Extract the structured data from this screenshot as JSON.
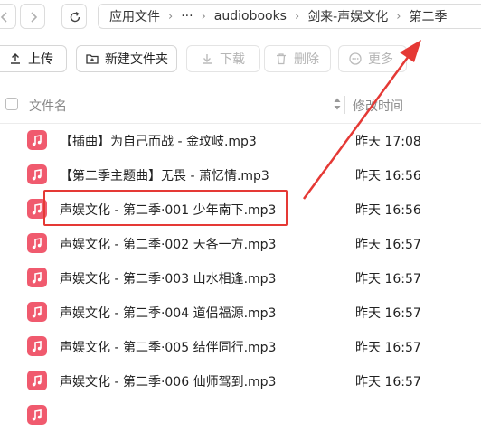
{
  "nav": {
    "back_icon": "chevron-left-icon",
    "forward_icon": "chevron-right-icon",
    "refresh_icon": "refresh-icon"
  },
  "breadcrumb": {
    "items": [
      "应用文件",
      "···",
      "audiobooks",
      "剑来-声娱文化",
      "第二季"
    ]
  },
  "toolbar": {
    "upload": "上传",
    "new_folder": "新建文件夹",
    "download": "下载",
    "delete": "删除",
    "more": "更多"
  },
  "list": {
    "header": {
      "name": "文件名",
      "modified": "修改时间"
    },
    "rows": [
      {
        "name": "【插曲】为自己而战 - 金玟岐.mp3",
        "time": "昨天 17:08"
      },
      {
        "name": "【第二季主题曲】无畏 - 萧忆情.mp3",
        "time": "昨天 16:56"
      },
      {
        "name": "声娱文化 - 第二季·001 少年南下.mp3",
        "time": "昨天 16:56"
      },
      {
        "name": "声娱文化 - 第二季·002 天各一方.mp3",
        "time": "昨天 16:57"
      },
      {
        "name": "声娱文化 - 第二季·003 山水相逢.mp3",
        "time": "昨天 16:57"
      },
      {
        "name": "声娱文化 - 第二季·004 道侣福源.mp3",
        "time": "昨天 16:57"
      },
      {
        "name": "声娱文化 - 第二季·005 结伴同行.mp3",
        "time": "昨天 16:57"
      },
      {
        "name": "声娱文化 - 第二季·006 仙师驾到.mp3",
        "time": "昨天 16:57"
      },
      {
        "name": "",
        "time": ""
      }
    ]
  },
  "colors": {
    "file_icon": "#f05a6e",
    "highlight": "#e53935",
    "annotation_arrow": "#e53935"
  }
}
